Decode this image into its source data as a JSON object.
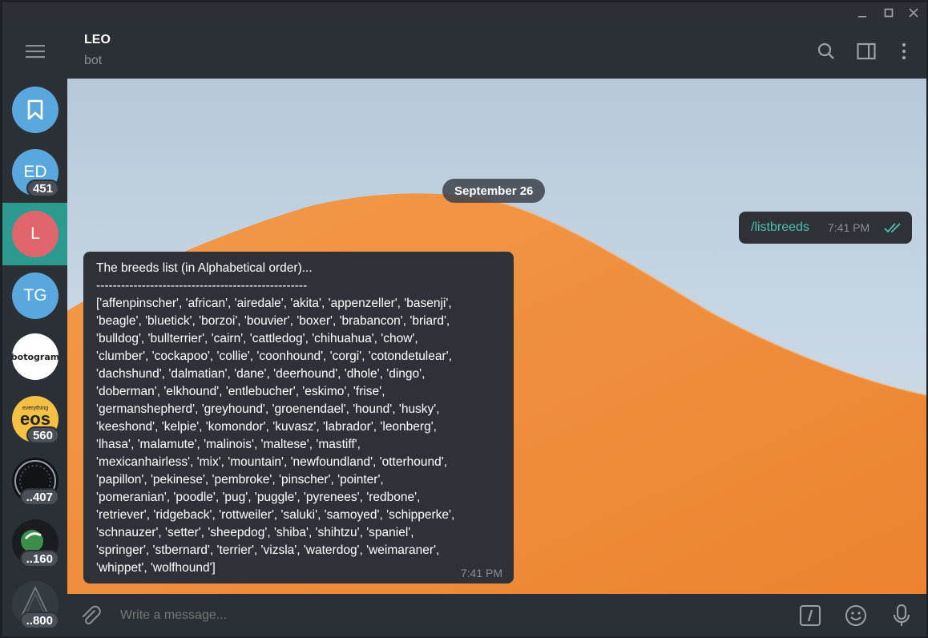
{
  "header": {
    "title": "LEO",
    "subtitle": "bot"
  },
  "chats": [
    {
      "initials": "",
      "color": "#5aa7de",
      "icon": "bookmark-icon",
      "badge": ""
    },
    {
      "initials": "ED",
      "color": "#5aa7de",
      "badge": "451"
    },
    {
      "initials": "L",
      "color": "#e0666e",
      "badge": "",
      "active": true
    },
    {
      "initials": "TG",
      "color": "#5aa7de",
      "badge": ""
    },
    {
      "initials": "",
      "logo_text": "botogram",
      "color": "#ffffff",
      "badge": ""
    },
    {
      "initials": "",
      "logo_text": "eos",
      "logo_small": "everything",
      "color": "#f5c144",
      "badge": "560"
    },
    {
      "initials": "",
      "color": "#111417",
      "icon": "dial-logo-icon",
      "badge": "..407"
    },
    {
      "initials": "",
      "color": "#1a1c1f",
      "icon": "green-logo-icon",
      "badge": "..160"
    },
    {
      "initials": "",
      "color": "#333a40",
      "icon": "triangle-logo-icon",
      "badge": "..800"
    }
  ],
  "conversation": {
    "date": "September 26",
    "outgoing": {
      "text": "/listbreeds",
      "time": "7:41 PM",
      "status_color": "#4fc0b0"
    },
    "incoming": {
      "text": "The breeds list (in Alphabetical order)...\n---------------------------------------------------\n['affenpinscher', 'african', 'airedale', 'akita', 'appenzeller', 'basenji',\n'beagle', 'bluetick', 'borzoi', 'bouvier', 'boxer', 'brabancon', 'briard',\n'bulldog', 'bullterrier', 'cairn', 'cattledog', 'chihuahua', 'chow',\n'clumber', 'cockapoo', 'collie', 'coonhound', 'corgi', 'cotondetulear',\n'dachshund', 'dalmatian', 'dane', 'deerhound', 'dhole', 'dingo',\n'doberman', 'elkhound', 'entlebucher', 'eskimo', 'frise',\n'germanshepherd', 'greyhound', 'groenendael', 'hound', 'husky',\n'keeshond', 'kelpie', 'komondor', 'kuvasz', 'labrador', 'leonberg',\n'lhasa', 'malamute', 'malinois', 'maltese', 'mastiff',\n'mexicanhairless', 'mix', 'mountain', 'newfoundland', 'otterhound',\n'papillon', 'pekinese', 'pembroke', 'pinscher', 'pointer',\n'pomeranian', 'poodle', 'pug', 'puggle', 'pyrenees', 'redbone',\n'retriever', 'ridgeback', 'rottweiler', 'saluki', 'samoyed', 'schipperke',\n'schnauzer', 'setter', 'sheepdog', 'shiba', 'shihtzu', 'spaniel',\n'springer', 'stbernard', 'terrier', 'vizsla', 'waterdog', 'weimaraner',\n'whippet', 'wolfhound']",
      "time": "7:41 PM"
    }
  },
  "composer": {
    "placeholder": "Write a message..."
  },
  "colors": {
    "accent": "#2c9a8f",
    "dune": "#f08c3a",
    "sky": "#c6d6e3"
  }
}
